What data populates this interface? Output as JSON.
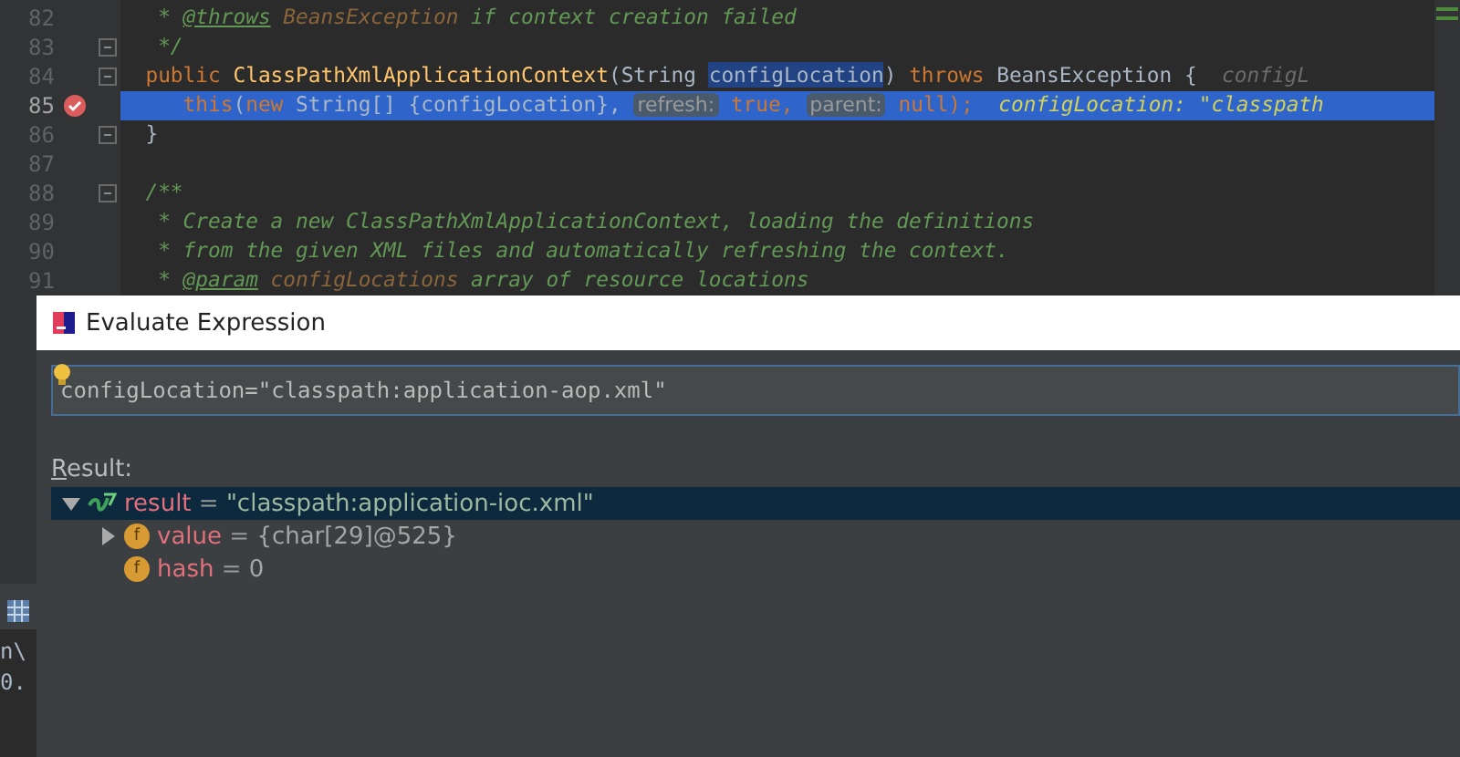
{
  "editor": {
    "lines": [
      {
        "number": "82",
        "fold": false,
        "breakpoint": false,
        "highlighted": false,
        "tokens": [
          {
            "text": "   * ",
            "kind": "doc"
          },
          {
            "text": "@throws",
            "kind": "doc-tag"
          },
          {
            "text": " BeansException ",
            "kind": "doc-ref"
          },
          {
            "text": "if context creation failed",
            "kind": "doc"
          }
        ]
      },
      {
        "number": "83",
        "fold": true,
        "breakpoint": false,
        "highlighted": false,
        "tokens": [
          {
            "text": "   */",
            "kind": "doc"
          }
        ]
      },
      {
        "number": "84",
        "fold": true,
        "breakpoint": false,
        "highlighted": false,
        "tokens": [
          {
            "text": "  public ",
            "kind": "keyword"
          },
          {
            "text": "ClassPathXmlApplicationContext",
            "kind": "method"
          },
          {
            "text": "(String ",
            "kind": "plain"
          },
          {
            "text": "configLocation",
            "kind": "selected-word"
          },
          {
            "text": ") ",
            "kind": "plain"
          },
          {
            "text": "throws ",
            "kind": "keyword"
          },
          {
            "text": "BeansException {",
            "kind": "plain"
          },
          {
            "text": "  configL",
            "kind": "inline-value-dim"
          }
        ]
      },
      {
        "number": "85",
        "fold": false,
        "breakpoint": true,
        "highlighted": true,
        "tokens": [
          {
            "text": "     this",
            "kind": "keyword"
          },
          {
            "text": "(",
            "kind": "plain"
          },
          {
            "text": "new ",
            "kind": "keyword"
          },
          {
            "text": "String[] {configLocation}, ",
            "kind": "plain"
          },
          {
            "text": "refresh:",
            "kind": "hint"
          },
          {
            "text": " true, ",
            "kind": "keyword"
          },
          {
            "text": "parent:",
            "kind": "hint"
          },
          {
            "text": " null);",
            "kind": "keyword"
          },
          {
            "text": "  configLocation: \"classpath",
            "kind": "inline-value"
          }
        ]
      },
      {
        "number": "86",
        "fold": true,
        "breakpoint": false,
        "highlighted": false,
        "tokens": [
          {
            "text": "  }",
            "kind": "plain"
          }
        ]
      },
      {
        "number": "87",
        "fold": false,
        "breakpoint": false,
        "highlighted": false
      },
      {
        "number": "88",
        "fold": true,
        "breakpoint": false,
        "highlighted": false,
        "tokens": [
          {
            "text": "  /**",
            "kind": "doc"
          }
        ]
      },
      {
        "number": "89",
        "fold": false,
        "breakpoint": false,
        "highlighted": false,
        "tokens": [
          {
            "text": "   * Create a new ClassPathXmlApplicationContext, loading the definitions",
            "kind": "doc"
          }
        ]
      },
      {
        "number": "90",
        "fold": false,
        "breakpoint": false,
        "highlighted": false,
        "tokens": [
          {
            "text": "   * from the given XML files and automatically refreshing the context.",
            "kind": "doc"
          }
        ]
      },
      {
        "number": "91",
        "fold": false,
        "breakpoint": false,
        "highlighted": false,
        "tokens": [
          {
            "text": "   * ",
            "kind": "doc"
          },
          {
            "text": "@param",
            "kind": "doc-tag"
          },
          {
            "text": " configLocations ",
            "kind": "doc-ref"
          },
          {
            "text": "array of resource locations",
            "kind": "doc"
          }
        ]
      }
    ]
  },
  "background_panel": {
    "lines": [
      "n\\",
      "0."
    ]
  },
  "dialog": {
    "title": "Evaluate Expression",
    "expression": "configLocation=\"classpath:application-aop.xml\"",
    "result_label": "Result:",
    "tree": [
      {
        "name": "result",
        "operator": "=",
        "value": "\"classpath:application-ioc.xml\"",
        "kind": "watch",
        "selected": true,
        "expanded": true,
        "children": [
          {
            "name": "value",
            "operator": "=",
            "value": "{char[29]@525}",
            "kind": "field",
            "badge": "f",
            "selected": false,
            "expanded": false
          },
          {
            "name": "hash",
            "operator": "=",
            "value": "0",
            "kind": "field",
            "badge": "f",
            "selected": false
          }
        ]
      }
    ]
  }
}
